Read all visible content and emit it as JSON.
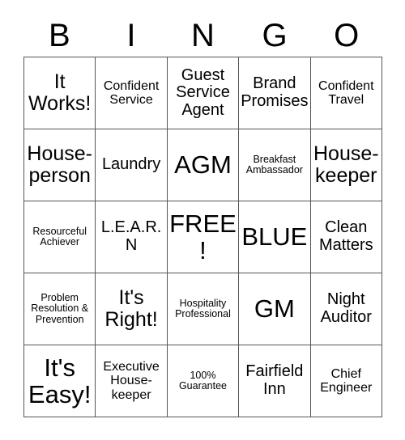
{
  "title": "BINGO Card",
  "header": {
    "letters": [
      "B",
      "I",
      "N",
      "G",
      "O"
    ]
  },
  "grid": {
    "rows": 5,
    "columns": 5,
    "free_space": "FREE!",
    "cells": [
      [
        {
          "text": "It Works!",
          "size": "lg"
        },
        {
          "text": "Confident Service",
          "size": "sm"
        },
        {
          "text": "Guest Service Agent",
          "size": "md"
        },
        {
          "text": "Brand Promises",
          "size": "md"
        },
        {
          "text": "Confident Travel",
          "size": "sm"
        }
      ],
      [
        {
          "text": "House-person",
          "size": "lg"
        },
        {
          "text": "Laundry",
          "size": "md"
        },
        {
          "text": "AGM",
          "size": "xl"
        },
        {
          "text": "Breakfast Ambassador",
          "size": "xs"
        },
        {
          "text": "House-keeper",
          "size": "lg"
        }
      ],
      [
        {
          "text": "Resourceful Achiever",
          "size": "xs"
        },
        {
          "text": "L.E.A.R.N",
          "size": "md"
        },
        {
          "text": "FREE!",
          "size": "xl"
        },
        {
          "text": "BLUE",
          "size": "xl"
        },
        {
          "text": "Clean Matters",
          "size": "md"
        }
      ],
      [
        {
          "text": "Problem Resolution & Prevention",
          "size": "xs"
        },
        {
          "text": "It's Right!",
          "size": "lg"
        },
        {
          "text": "Hospitality Professional",
          "size": "xs"
        },
        {
          "text": "GM",
          "size": "xl"
        },
        {
          "text": "Night Auditor",
          "size": "md"
        }
      ],
      [
        {
          "text": "It's Easy!",
          "size": "xl"
        },
        {
          "text": "Executive House-keeper",
          "size": "sm"
        },
        {
          "text": "100% Guarantee",
          "size": "xs"
        },
        {
          "text": "Fairfield Inn",
          "size": "md"
        },
        {
          "text": "Chief Engineer",
          "size": "sm"
        }
      ]
    ]
  },
  "colors": {
    "background": "#ffffff",
    "text": "#000000",
    "border": "#555555"
  }
}
